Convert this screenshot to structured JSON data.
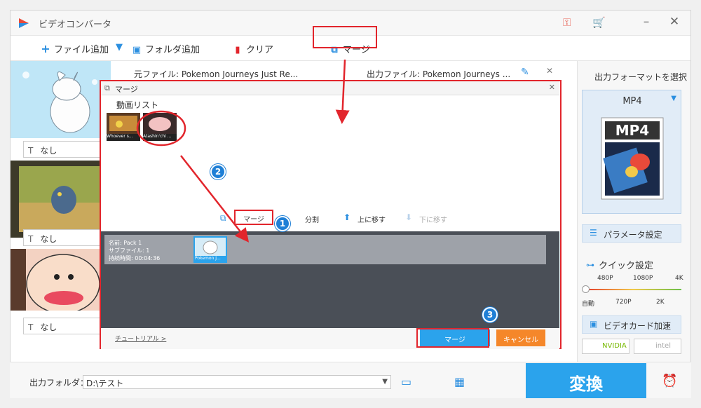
{
  "app": {
    "title": "ビデオコンバータ"
  },
  "toolbar": {
    "add_file": "ファイル追加",
    "add_folder": "フォルダ追加",
    "clear": "クリア",
    "merge": "マージ"
  },
  "file_info": {
    "source": "元ファイル: Pokemon Journeys Just Re...",
    "output": "出力ファイル: Pokemon Journeys ..."
  },
  "left_list": {
    "items": [
      {
        "subtitle": "なし"
      },
      {
        "subtitle": "なし"
      },
      {
        "subtitle": "なし"
      }
    ]
  },
  "dialog": {
    "title": "マージ",
    "video_list_label": "動画リスト",
    "videos": [
      {
        "name": "Whoever s..."
      },
      {
        "name": "Atashin'chi ..."
      }
    ],
    "actions": {
      "merge": "マージ",
      "split": "分割",
      "move_up": "上に移す",
      "move_down": "下に移す"
    },
    "pack": {
      "name": "名前: Pack 1",
      "subfiles": "サブファイル: 1",
      "duration": "持続時間: 00:04:36",
      "clip_name": "Pokemon J..."
    },
    "tutorial": "チュートリアル >",
    "merge_button": "マージ",
    "cancel_button": "キャンセル"
  },
  "right_panel": {
    "format_heading": "出力フォーマットを選択",
    "format": "MP4",
    "format_icon_text": "MP4",
    "param_settings": "パラメータ設定",
    "quick_settings": "クイック設定",
    "quality_top": [
      "480P",
      "1080P",
      "4K"
    ],
    "quality_bottom": [
      "自動",
      "720P",
      "2K"
    ],
    "gpu_accel": "ビデオカード加速",
    "nvidia": "NVIDIA",
    "intel": "intel"
  },
  "bottom": {
    "output_folder_label": "出力フォルダ：",
    "output_folder_value": "D:\\テスト",
    "convert": "変換"
  },
  "annotations": {
    "step1": "1",
    "step2": "2",
    "step3": "3"
  },
  "colors": {
    "accent_blue": "#2ba3ec",
    "annotation_red": "#e2252c",
    "cancel_orange": "#f5872a",
    "badge_blue": "#1e7fd6"
  }
}
